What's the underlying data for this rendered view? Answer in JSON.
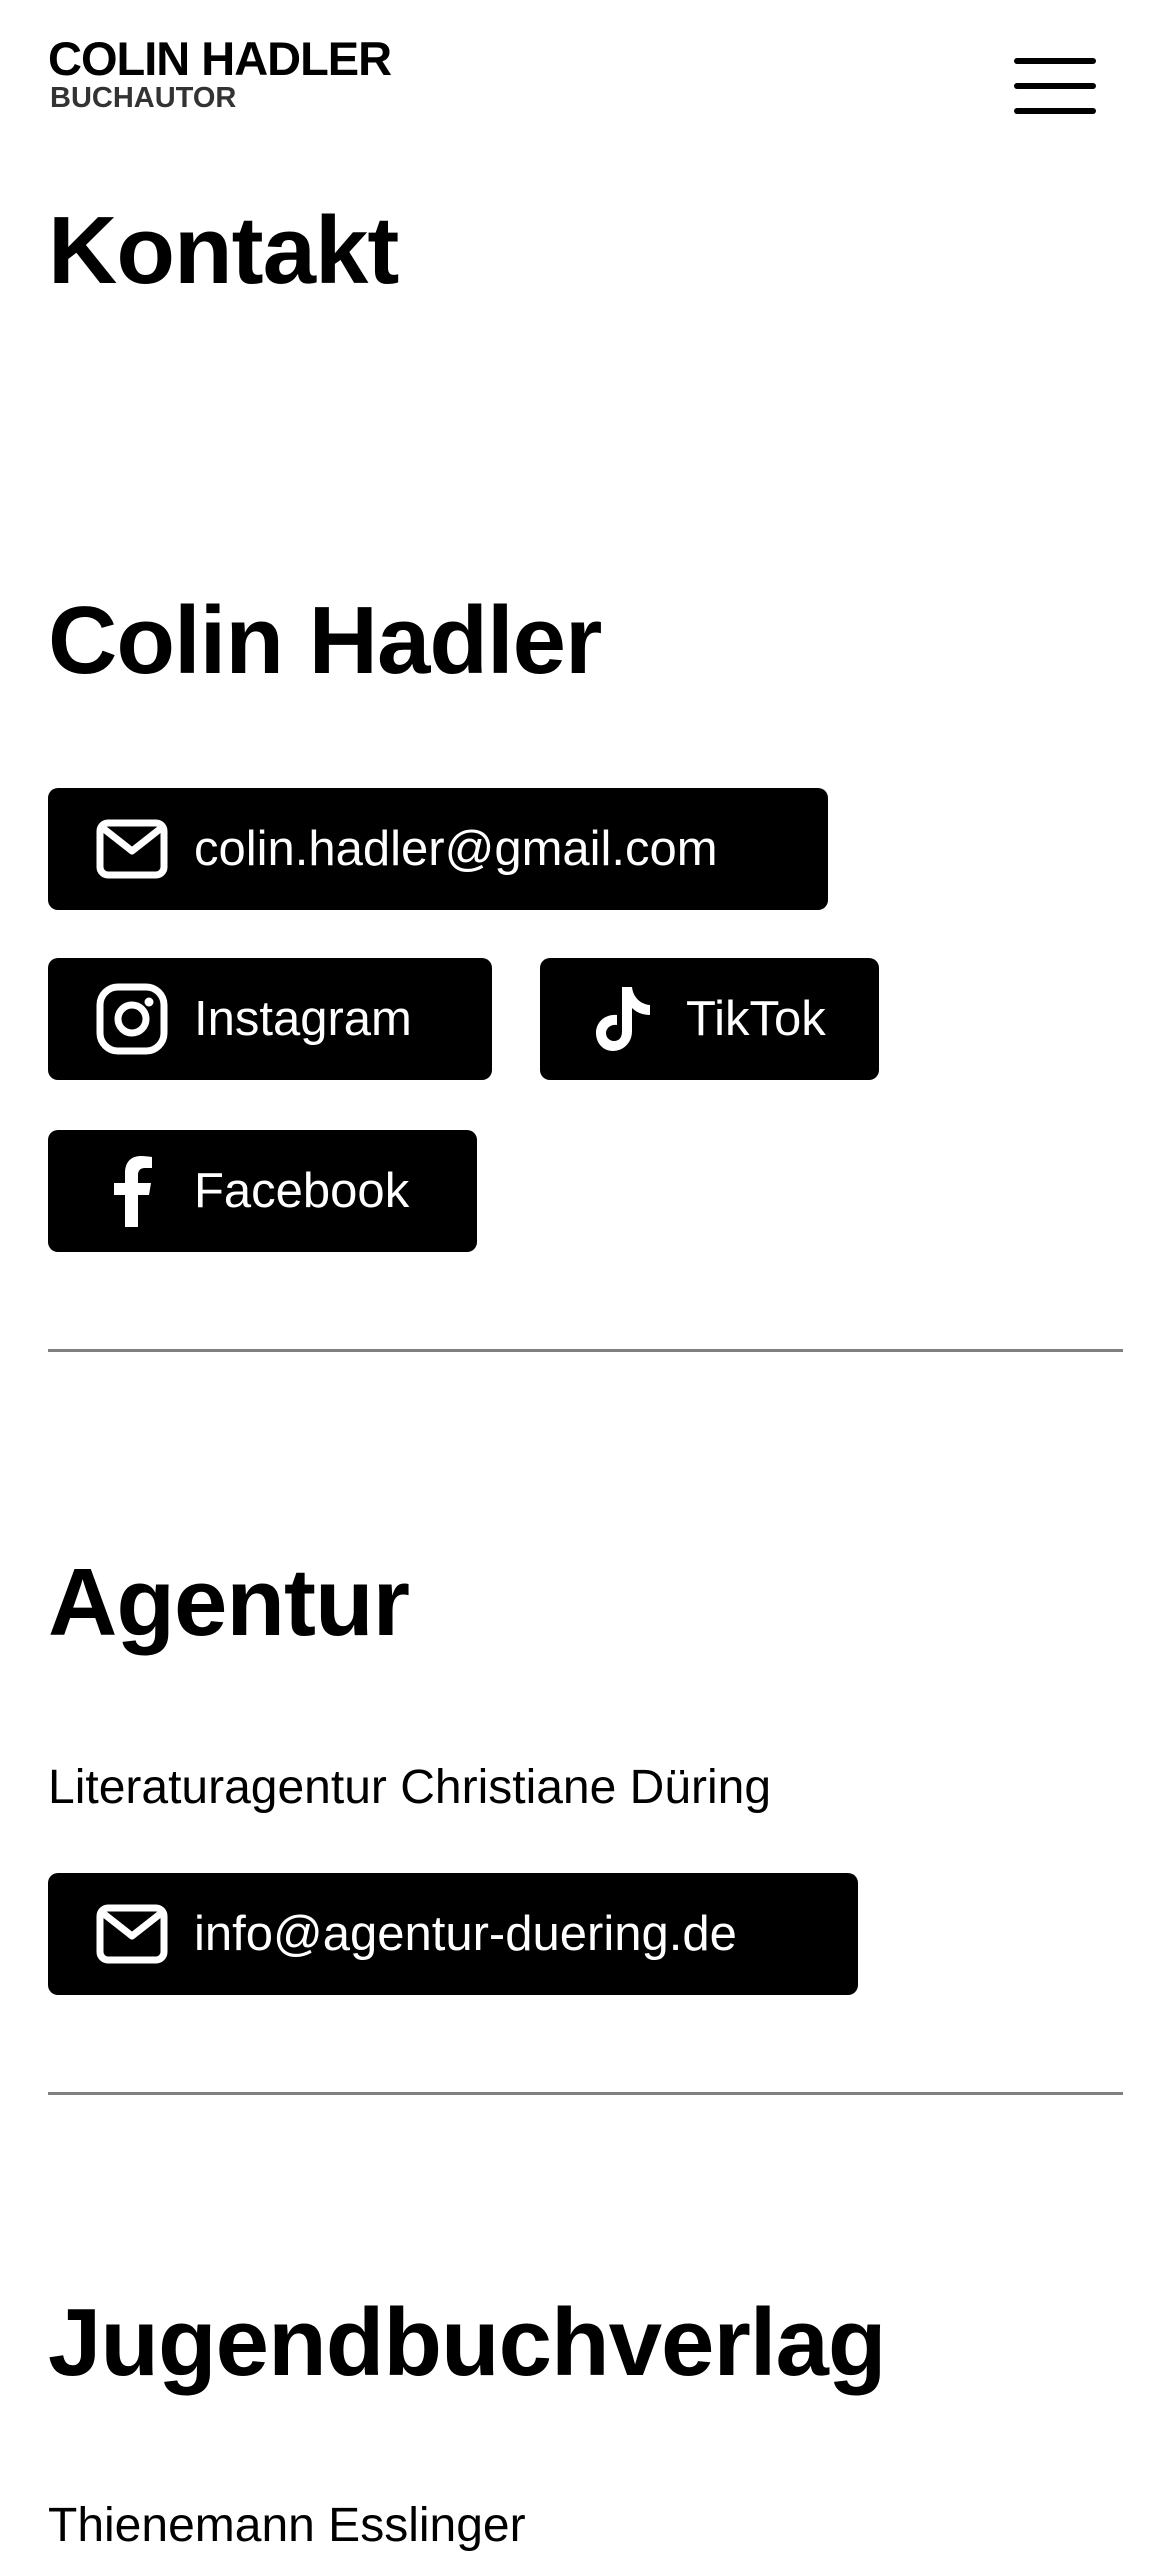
{
  "header": {
    "brand_name": "COLIN HADLER",
    "brand_subtitle": "BUCHAUTOR",
    "menu_icon": "hamburger-menu-icon"
  },
  "page": {
    "title": "Kontakt"
  },
  "author": {
    "title": "Colin Hadler",
    "email_label": "colin.hadler@gmail.com",
    "email_icon": "mail-icon",
    "instagram_label": "Instagram",
    "instagram_icon": "instagram-icon",
    "tiktok_label": "TikTok",
    "tiktok_icon": "tiktok-icon",
    "facebook_label": "Facebook",
    "facebook_icon": "facebook-icon"
  },
  "agency": {
    "title": "Agentur",
    "name": "Literaturagentur Christiane Düring",
    "email_label": "info@agentur-duering.de",
    "email_icon": "mail-icon"
  },
  "publisher": {
    "title": "Jugendbuchverlag",
    "name": "Thienemann Esslinger"
  },
  "colors": {
    "background": "#ffffff",
    "text": "#000000",
    "button_background": "#000000",
    "button_text": "#ffffff",
    "divider": "#808080"
  }
}
